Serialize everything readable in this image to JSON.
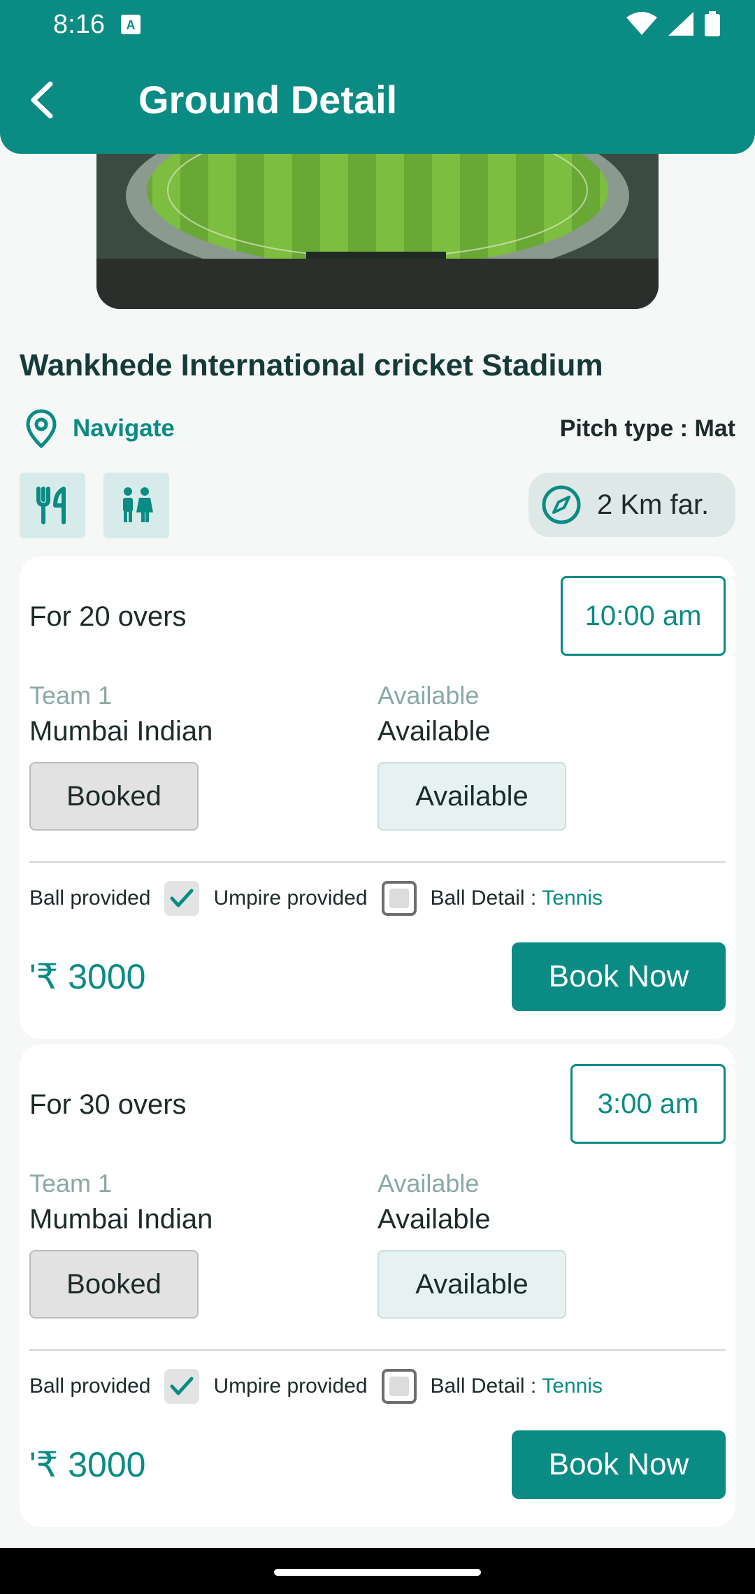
{
  "status_bar": {
    "time": "8:16"
  },
  "header": {
    "title": "Ground Detail"
  },
  "ground": {
    "name": "Wankhede International cricket Stadium",
    "navigate_label": "Navigate",
    "pitch_type": "Pitch type : Mat",
    "distance": "2 Km far.",
    "amenities": [
      "restaurant-icon",
      "restroom-icon"
    ]
  },
  "slots": [
    {
      "overs": "For 20 overs",
      "time": "10:00 am",
      "team1_label": "Team 1",
      "team1_value": "Mumbai Indian",
      "team2_label": "Available",
      "team2_value": "Available",
      "team1_status": "Booked",
      "team2_status": "Available",
      "ball_provided_label": "Ball provided",
      "ball_provided": true,
      "umpire_provided_label": "Umpire provided",
      "umpire_provided": false,
      "ball_detail_label": "Ball Detail :",
      "ball_detail_value": "Tennis",
      "price": "'₹ 3000",
      "book_label": "Book Now"
    },
    {
      "overs": "For 30 overs",
      "time": "3:00 am",
      "team1_label": "Team 1",
      "team1_value": "Mumbai Indian",
      "team2_label": "Available",
      "team2_value": "Available",
      "team1_status": "Booked",
      "team2_status": "Available",
      "ball_provided_label": "Ball provided",
      "ball_provided": true,
      "umpire_provided_label": "Umpire provided",
      "umpire_provided": false,
      "ball_detail_label": "Ball Detail :",
      "ball_detail_value": "Tennis",
      "price": "'₹ 3000",
      "book_label": "Book Now"
    }
  ],
  "colors": {
    "primary": "#0a8b84",
    "card": "#ffffff",
    "background": "#f6f7f7"
  }
}
